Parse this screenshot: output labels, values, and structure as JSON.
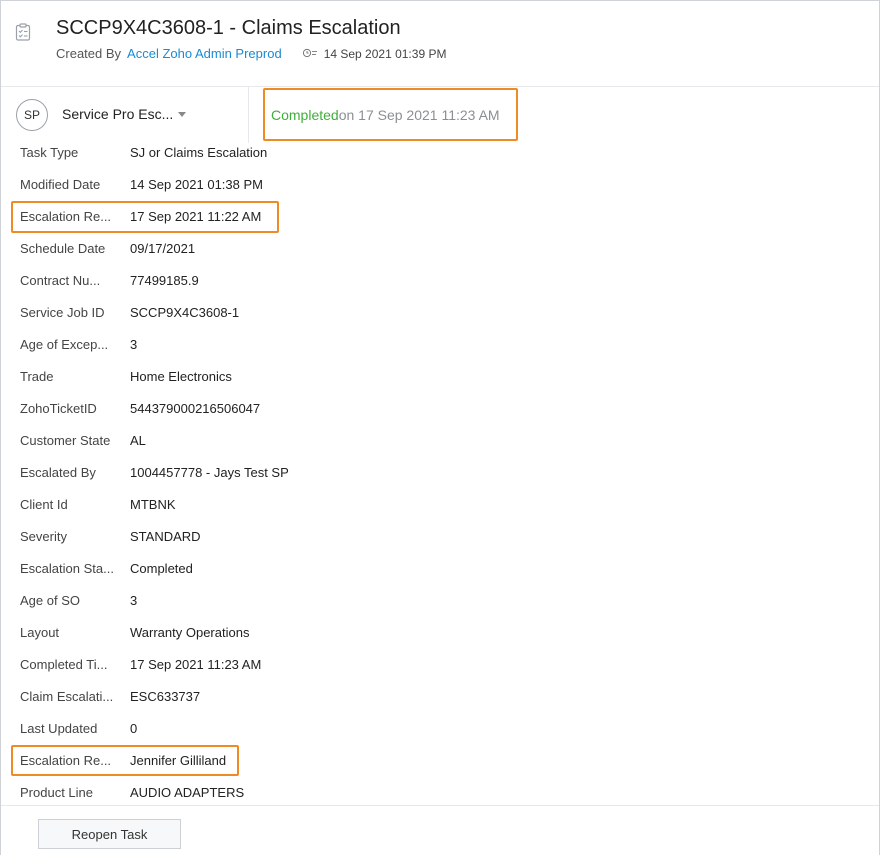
{
  "header": {
    "title": "SCCP9X4C3608-1 - Claims Escalation",
    "created_by_label": "Created By",
    "creator": "Accel Zoho Admin Preprod",
    "created_date": "14 Sep 2021 01:39 PM"
  },
  "owner": {
    "initials": "SP",
    "name": "Service Pro Esc..."
  },
  "status": {
    "state": "Completed",
    "on_text": " on 17 Sep 2021 11:23 AM"
  },
  "fields": [
    {
      "label": "Task Type",
      "value": "SJ or Claims Escalation"
    },
    {
      "label": "Modified Date",
      "value": "14 Sep 2021 01:38 PM"
    },
    {
      "label": "Escalation Re...",
      "value": "17 Sep 2021 11:22 AM"
    },
    {
      "label": "Schedule Date",
      "value": "09/17/2021"
    },
    {
      "label": "Contract Nu...",
      "value": "77499185.9"
    },
    {
      "label": "Service Job ID",
      "value": "SCCP9X4C3608-1"
    },
    {
      "label": "Age of Excep...",
      "value": "3"
    },
    {
      "label": "Trade",
      "value": "Home Electronics"
    },
    {
      "label": "ZohoTicketID",
      "value": "544379000216506047"
    },
    {
      "label": "Customer State",
      "value": "AL"
    },
    {
      "label": "Escalated By",
      "value": "1004457778 - Jays Test SP"
    },
    {
      "label": "Client Id",
      "value": "MTBNK"
    },
    {
      "label": "Severity",
      "value": "STANDARD"
    },
    {
      "label": "Escalation Sta...",
      "value": "Completed"
    },
    {
      "label": "Age of SO",
      "value": "3"
    },
    {
      "label": "Layout",
      "value": "Warranty Operations"
    },
    {
      "label": "Completed Ti...",
      "value": "17 Sep 2021 11:23 AM"
    },
    {
      "label": "Claim Escalati...",
      "value": "ESC633737"
    },
    {
      "label": "Last Updated",
      "value": "0"
    },
    {
      "label": "Escalation Re...",
      "value": "Jennifer Gilliland"
    },
    {
      "label": "Product Line",
      "value": "AUDIO ADAPTERS"
    }
  ],
  "footer": {
    "reopen_label": "Reopen Task"
  },
  "colors": {
    "highlight": "#f08a24",
    "link": "#1a8bd1",
    "completed": "#3fae3a"
  }
}
